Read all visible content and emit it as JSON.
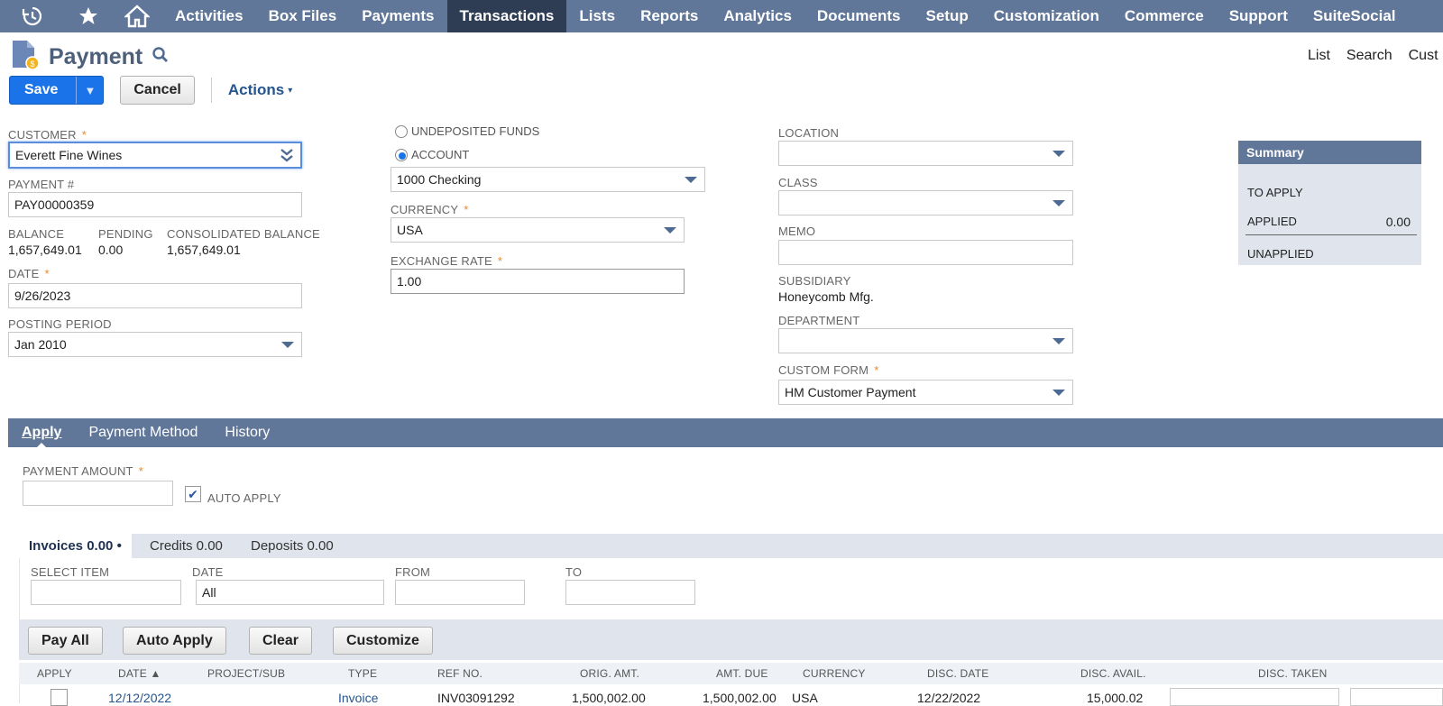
{
  "nav": {
    "menu": [
      "Activities",
      "Box Files",
      "Payments",
      "Transactions",
      "Lists",
      "Reports",
      "Analytics",
      "Documents",
      "Setup",
      "Customization",
      "Commerce",
      "Support",
      "SuiteSocial"
    ],
    "active": "Transactions"
  },
  "page": {
    "title": "Payment",
    "right_links": [
      "List",
      "Search",
      "Cust"
    ]
  },
  "buttons": {
    "save": "Save",
    "save_dropdown": "▼",
    "cancel": "Cancel",
    "actions": "Actions",
    "actions_caret": "▾"
  },
  "form": {
    "customer_label": "CUSTOMER",
    "customer_value": "Everett Fine Wines",
    "payment_no_label": "PAYMENT #",
    "payment_no_value": "PAY00000359",
    "balance_label": "BALANCE",
    "balance_value": "1,657,649.01",
    "pending_label": "PENDING",
    "pending_value": "0.00",
    "consolidated_label": "CONSOLIDATED BALANCE",
    "consolidated_value": "1,657,649.01",
    "date_label": "DATE",
    "date_value": "9/26/2023",
    "posting_label": "POSTING PERIOD",
    "posting_value": "Jan 2010",
    "undeposited_label": "UNDEPOSITED FUNDS",
    "account_label": "ACCOUNT",
    "account_selected": true,
    "account_value": "1000 Checking",
    "currency_label": "CURRENCY",
    "currency_value": "USA",
    "exchange_label": "EXCHANGE RATE",
    "exchange_value": "1.00",
    "location_label": "LOCATION",
    "class_label": "CLASS",
    "memo_label": "MEMO",
    "subsidiary_label": "SUBSIDIARY",
    "subsidiary_value": "Honeycomb Mfg.",
    "department_label": "DEPARTMENT",
    "custom_form_label": "CUSTOM FORM",
    "custom_form_value": "HM Customer Payment",
    "required_mark": "*"
  },
  "summary": {
    "title": "Summary",
    "to_apply": "TO APPLY",
    "applied": "APPLIED",
    "applied_value": "0.00",
    "unapplied": "UNAPPLIED"
  },
  "subtabs": [
    "Apply",
    "Payment Method",
    "History"
  ],
  "apply": {
    "payment_amount_label": "PAYMENT AMOUNT",
    "auto_apply_label": "AUTO APPLY",
    "auto_apply_checked": true
  },
  "inner_tabs": {
    "invoices": "Invoices 0.00",
    "invoices_dot": "•",
    "credits": "Credits 0.00",
    "deposits": "Deposits 0.00"
  },
  "filters": {
    "select_item_label": "SELECT ITEM",
    "date_label": "DATE",
    "date_value": "All",
    "from_label": "FROM",
    "to_label": "TO"
  },
  "grid_buttons": [
    "Pay All",
    "Auto Apply",
    "Clear",
    "Customize"
  ],
  "columns": [
    "APPLY",
    "DATE ▲",
    "PROJECT/SUB",
    "TYPE",
    "REF NO.",
    "ORIG. AMT.",
    "AMT. DUE",
    "CURRENCY",
    "DISC. DATE",
    "DISC. AVAIL.",
    "DISC. TAKEN"
  ],
  "rows": [
    {
      "date": "12/12/2022",
      "type": "Invoice",
      "ref": "INV03091292",
      "orig": "1,500,002.00",
      "due": "1,500,002.00",
      "currency": "USA",
      "disc_date": "12/22/2022",
      "disc_avail": "15,000.02"
    }
  ]
}
